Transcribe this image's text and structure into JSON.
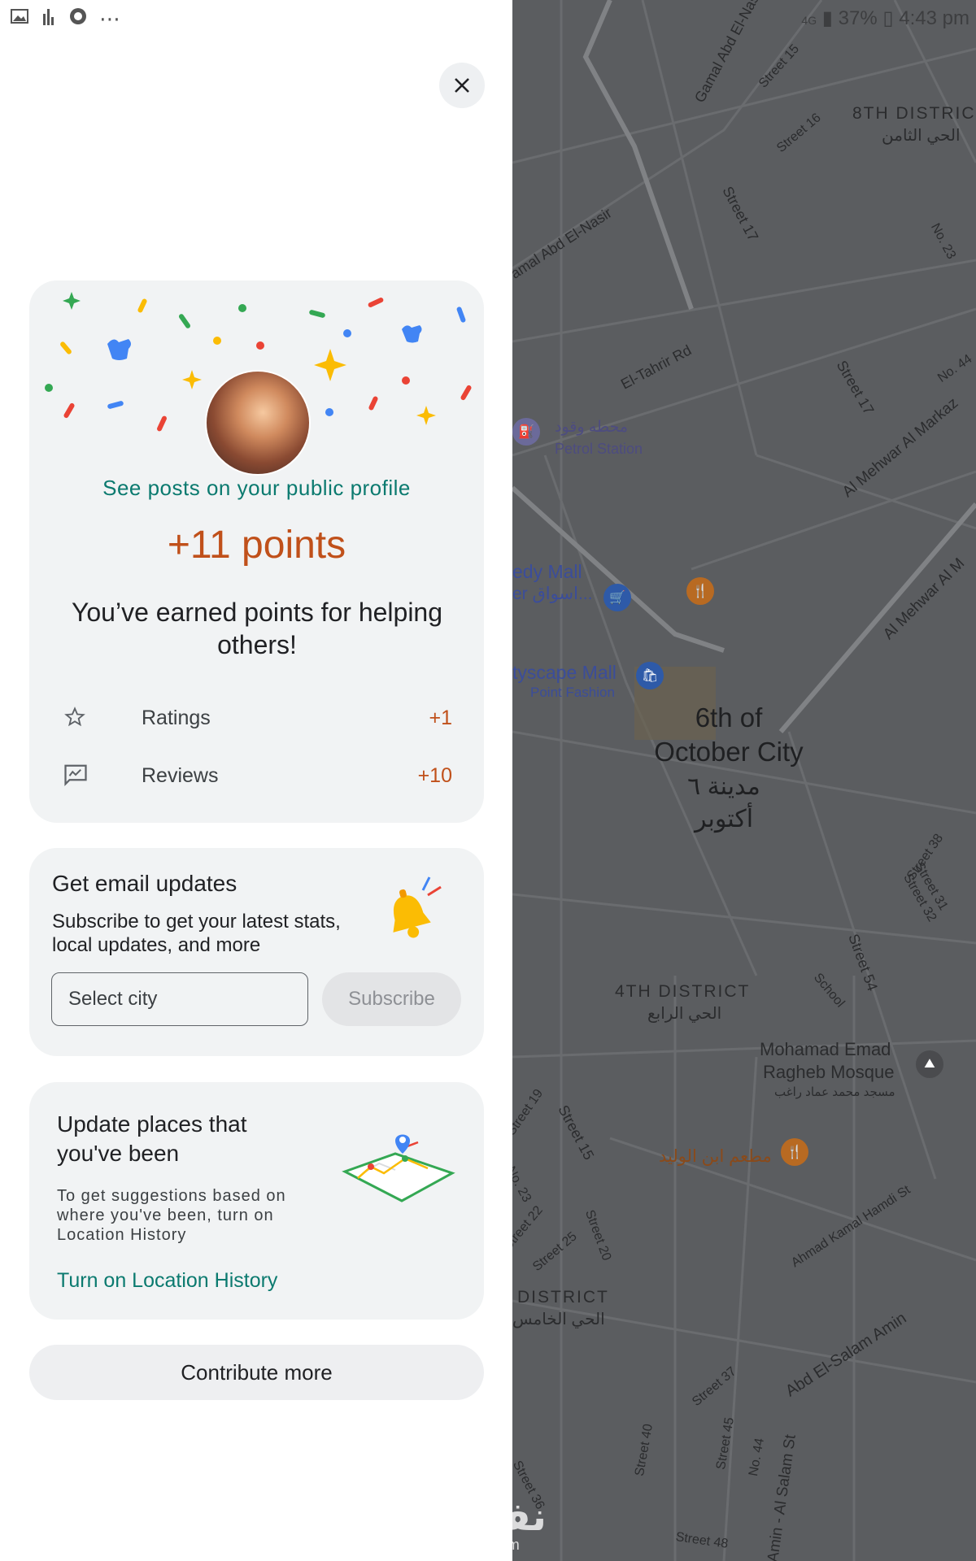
{
  "status_bar": {
    "battery": "37%",
    "time": "4:43 pm",
    "network": "4G"
  },
  "profile_card": {
    "link": "See posts on your public profile",
    "points": "+11 points",
    "message": "You’ve earned points for helping others!",
    "rows": [
      {
        "icon": "star-icon",
        "label": "Ratings",
        "value": "+1"
      },
      {
        "icon": "review-icon",
        "label": "Reviews",
        "value": "+10"
      }
    ]
  },
  "email_card": {
    "title": "Get email updates",
    "description": "Subscribe to get your latest stats, local updates, and more",
    "city_placeholder": "Select city",
    "subscribe_label": "Subscribe"
  },
  "history_card": {
    "title": "Update places that you've been",
    "description": "To get suggestions based on where you've been, turn on Location History",
    "link": "Turn on Location History"
  },
  "contribute_label": "Contribute more",
  "map": {
    "city_name": "6th of October City",
    "city_name_ar": "مدينة ٦ أكتوبر",
    "labels": [
      {
        "text": "8TH DISTRIC"
      },
      {
        "text": "الحي الثامن"
      },
      {
        "text": "Gamal Abd El-Nasir"
      },
      {
        "text": "amal Abd El-Nasir"
      },
      {
        "text": "Street 15"
      },
      {
        "text": "Street 16"
      },
      {
        "text": "Street 17"
      },
      {
        "text": "No. 23"
      },
      {
        "text": "El-Tahrir Rd"
      },
      {
        "text": "Street 17"
      },
      {
        "text": "No. 44"
      },
      {
        "text": "Al Mehwar Al Markaz"
      },
      {
        "text": "محطه وقود"
      },
      {
        "text": "Petrol Station"
      },
      {
        "text": "edy Mall"
      },
      {
        "text": "er اسواق..."
      },
      {
        "text": "Al Mehwar Al M"
      },
      {
        "text": "tyscape Mall"
      },
      {
        "text": "Point Fashion"
      },
      {
        "text": "4TH DISTRICT"
      },
      {
        "text": "الحي الرابع"
      },
      {
        "text": "School"
      },
      {
        "text": "Street 54"
      },
      {
        "text": "Street 38"
      },
      {
        "text": "Street 31"
      },
      {
        "text": "Street 32"
      },
      {
        "text": "Mohamad Emad"
      },
      {
        "text": "Ragheb Mosque"
      },
      {
        "text": "مسجد محمد عماد راغب"
      },
      {
        "text": "مطعم ابن الوليد"
      },
      {
        "text": "Street 19"
      },
      {
        "text": "Street 15"
      },
      {
        "text": "No. 23"
      },
      {
        "text": "Street 22"
      },
      {
        "text": "Street 25"
      },
      {
        "text": "Street 20"
      },
      {
        "text": "Ahmad Kamal Hamdi St"
      },
      {
        "text": "DISTRICT"
      },
      {
        "text": "الحي الخامس"
      },
      {
        "text": "Abd El-Salam Amin"
      },
      {
        "text": "Street 37"
      },
      {
        "text": "Street 40"
      },
      {
        "text": "Street 45"
      },
      {
        "text": "No. 44"
      },
      {
        "text": "Amin - Al Salam St"
      },
      {
        "text": "Street 36"
      },
      {
        "text": "Street 48"
      }
    ]
  },
  "watermark": {
    "text": "نفذلي",
    "sub": "nafezly.com"
  },
  "colors": {
    "accent_teal": "#0b7a6f",
    "points_orange": "#c0501a",
    "map_bg": "#5b5d60"
  }
}
